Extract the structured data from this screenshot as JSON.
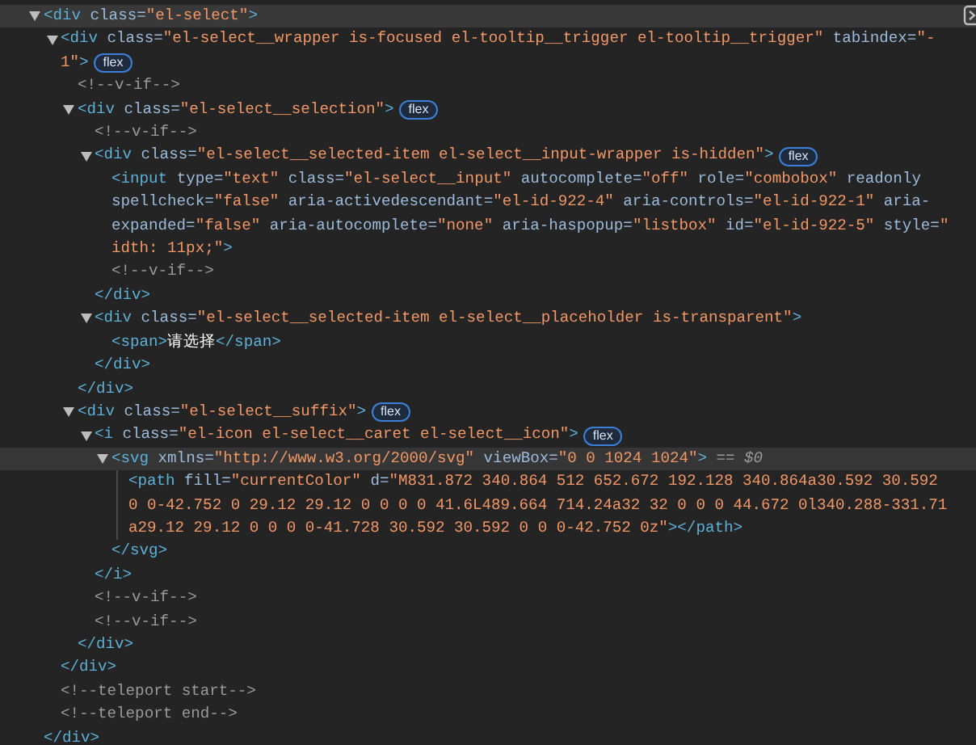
{
  "dom_tree": {
    "nodes": [
      {
        "kind": "element",
        "expanded": true,
        "selected": false,
        "hovered": true,
        "lines": [
          [
            {
              "kind": "tag",
              "text": "<div "
            },
            {
              "kind": "attr",
              "text": "class="
            },
            {
              "kind": "value",
              "text": "\"el-select\""
            },
            {
              "kind": "tag",
              "text": ">"
            }
          ]
        ],
        "children": [
          {
            "kind": "element",
            "expanded": true,
            "selected": false,
            "hovered": false,
            "badge": "flex",
            "lines": [
              [
                {
                  "kind": "tag",
                  "text": "<div "
                },
                {
                  "kind": "attr",
                  "text": "class="
                },
                {
                  "kind": "value",
                  "text": "\"el-select__wrapper is-focused el-tooltip__trigger el-tooltip__trigger\""
                },
                {
                  "kind": "attr",
                  "text": " tabindex="
                },
                {
                  "kind": "value",
                  "text": "\"-"
                }
              ],
              [
                {
                  "kind": "value",
                  "text": "1\""
                },
                {
                  "kind": "tag",
                  "text": ">"
                }
              ]
            ],
            "children": [
              {
                "kind": "comment",
                "text": "<!--v-if-->"
              },
              {
                "kind": "element",
                "expanded": true,
                "selected": false,
                "hovered": false,
                "badge": "flex",
                "lines": [
                  [
                    {
                      "kind": "tag",
                      "text": "<div "
                    },
                    {
                      "kind": "attr",
                      "text": "class="
                    },
                    {
                      "kind": "value",
                      "text": "\"el-select__selection\""
                    },
                    {
                      "kind": "tag",
                      "text": ">"
                    }
                  ]
                ],
                "children": [
                  {
                    "kind": "comment",
                    "text": "<!--v-if-->"
                  },
                  {
                    "kind": "element",
                    "expanded": true,
                    "selected": false,
                    "hovered": false,
                    "badge": "flex",
                    "lines": [
                      [
                        {
                          "kind": "tag",
                          "text": "<div "
                        },
                        {
                          "kind": "attr",
                          "text": "class="
                        },
                        {
                          "kind": "value",
                          "text": "\"el-select__selected-item el-select__input-wrapper is-hidden\""
                        },
                        {
                          "kind": "tag",
                          "text": ">"
                        }
                      ]
                    ],
                    "children": [
                      {
                        "kind": "leaf",
                        "lines": [
                          [
                            {
                              "kind": "tag",
                              "text": "<input "
                            },
                            {
                              "kind": "attr",
                              "text": "type="
                            },
                            {
                              "kind": "value",
                              "text": "\"text\""
                            },
                            {
                              "kind": "attr",
                              "text": " class="
                            },
                            {
                              "kind": "value",
                              "text": "\"el-select__input\""
                            },
                            {
                              "kind": "attr",
                              "text": " autocomplete="
                            },
                            {
                              "kind": "value",
                              "text": "\"off\""
                            },
                            {
                              "kind": "attr",
                              "text": " role="
                            },
                            {
                              "kind": "value",
                              "text": "\"combobox\""
                            },
                            {
                              "kind": "attr",
                              "text": " readonly"
                            }
                          ],
                          [
                            {
                              "kind": "attr",
                              "text": "spellcheck="
                            },
                            {
                              "kind": "value",
                              "text": "\"false\""
                            },
                            {
                              "kind": "attr",
                              "text": " aria-activedescendant="
                            },
                            {
                              "kind": "value",
                              "text": "\"el-id-922-4\""
                            },
                            {
                              "kind": "attr",
                              "text": " aria-controls="
                            },
                            {
                              "kind": "value",
                              "text": "\"el-id-922-1\""
                            },
                            {
                              "kind": "attr",
                              "text": " aria-"
                            }
                          ],
                          [
                            {
                              "kind": "attr",
                              "text": "expanded="
                            },
                            {
                              "kind": "value",
                              "text": "\"false\""
                            },
                            {
                              "kind": "attr",
                              "text": " aria-autocomplete="
                            },
                            {
                              "kind": "value",
                              "text": "\"none\""
                            },
                            {
                              "kind": "attr",
                              "text": " aria-haspopup="
                            },
                            {
                              "kind": "value",
                              "text": "\"listbox\""
                            },
                            {
                              "kind": "attr",
                              "text": " id="
                            },
                            {
                              "kind": "value",
                              "text": "\"el-id-922-5\""
                            },
                            {
                              "kind": "attr",
                              "text": " style="
                            },
                            {
                              "kind": "value",
                              "text": "\""
                            }
                          ],
                          [
                            {
                              "kind": "value",
                              "text": "idth: 11px;\""
                            },
                            {
                              "kind": "tag",
                              "text": ">"
                            }
                          ]
                        ]
                      },
                      {
                        "kind": "comment",
                        "text": "<!--v-if-->"
                      }
                    ],
                    "close": [
                      {
                        "kind": "tag",
                        "text": "</div>"
                      }
                    ]
                  },
                  {
                    "kind": "element",
                    "expanded": true,
                    "selected": false,
                    "hovered": false,
                    "lines": [
                      [
                        {
                          "kind": "tag",
                          "text": "<div "
                        },
                        {
                          "kind": "attr",
                          "text": "class="
                        },
                        {
                          "kind": "value",
                          "text": "\"el-select__selected-item el-select__placeholder is-transparent\""
                        },
                        {
                          "kind": "tag",
                          "text": ">"
                        }
                      ]
                    ],
                    "children": [
                      {
                        "kind": "leaf",
                        "lines": [
                          [
                            {
                              "kind": "tag",
                              "text": "<span>"
                            },
                            {
                              "kind": "text",
                              "text": "请选择"
                            },
                            {
                              "kind": "tag",
                              "text": "</span>"
                            }
                          ]
                        ]
                      }
                    ],
                    "close": [
                      {
                        "kind": "tag",
                        "text": "</div>"
                      }
                    ]
                  }
                ],
                "close": [
                  {
                    "kind": "tag",
                    "text": "</div>"
                  }
                ]
              },
              {
                "kind": "element",
                "expanded": true,
                "selected": false,
                "hovered": false,
                "badge": "flex",
                "lines": [
                  [
                    {
                      "kind": "tag",
                      "text": "<div "
                    },
                    {
                      "kind": "attr",
                      "text": "class="
                    },
                    {
                      "kind": "value",
                      "text": "\"el-select__suffix\""
                    },
                    {
                      "kind": "tag",
                      "text": ">"
                    }
                  ]
                ],
                "children": [
                  {
                    "kind": "element",
                    "expanded": true,
                    "selected": false,
                    "hovered": false,
                    "badge": "flex",
                    "lines": [
                      [
                        {
                          "kind": "tag",
                          "text": "<i "
                        },
                        {
                          "kind": "attr",
                          "text": "class="
                        },
                        {
                          "kind": "value",
                          "text": "\"el-icon el-select__caret el-select__icon\""
                        },
                        {
                          "kind": "tag",
                          "text": ">"
                        }
                      ]
                    ],
                    "children": [
                      {
                        "kind": "element",
                        "expanded": true,
                        "selected": true,
                        "hovered": false,
                        "lines": [
                          [
                            {
                              "kind": "tag",
                              "text": "<svg "
                            },
                            {
                              "kind": "attr",
                              "text": "xmlns="
                            },
                            {
                              "kind": "value",
                              "text": "\"http://www.w3.org/2000/svg\""
                            },
                            {
                              "kind": "attr",
                              "text": " viewBox="
                            },
                            {
                              "kind": "value",
                              "text": "\"0 0 1024 1024\""
                            },
                            {
                              "kind": "tag",
                              "text": ">"
                            }
                          ]
                        ],
                        "suffix": [
                          {
                            "kind": "eq",
                            "text": " == "
                          },
                          {
                            "kind": "var",
                            "text": "$0"
                          }
                        ],
                        "children": [
                          {
                            "kind": "leaf",
                            "lines": [
                              [
                                {
                                  "kind": "tag",
                                  "text": "<path "
                                },
                                {
                                  "kind": "attr",
                                  "text": "fill="
                                },
                                {
                                  "kind": "value",
                                  "text": "\"currentColor\""
                                },
                                {
                                  "kind": "attr",
                                  "text": " d="
                                },
                                {
                                  "kind": "value",
                                  "text": "\"M831.872 340.864 512 652.672 192.128 340.864a30.592 30.592"
                                }
                              ],
                              [
                                {
                                  "kind": "value",
                                  "text": "0 0-42.752 0 29.12 29.12 0 0 0 0 41.6L489.664 714.24a32 32 0 0 0 44.672 0l340.288-331.71"
                                }
                              ],
                              [
                                {
                                  "kind": "value",
                                  "text": "a29.12 29.12 0 0 0 0-41.728 30.592 30.592 0 0 0-42.752 0z\""
                                },
                                {
                                  "kind": "tag",
                                  "text": "></path>"
                                }
                              ]
                            ]
                          }
                        ],
                        "close": [
                          {
                            "kind": "tag",
                            "text": "</svg>"
                          }
                        ]
                      }
                    ],
                    "close": [
                      {
                        "kind": "tag",
                        "text": "</i>"
                      }
                    ]
                  },
                  {
                    "kind": "comment",
                    "text": "<!--v-if-->"
                  },
                  {
                    "kind": "comment",
                    "text": "<!--v-if-->"
                  }
                ],
                "close": [
                  {
                    "kind": "tag",
                    "text": "</div>"
                  }
                ]
              }
            ],
            "close": [
              {
                "kind": "tag",
                "text": "</div>"
              }
            ]
          },
          {
            "kind": "comment",
            "text": "<!--teleport start-->"
          },
          {
            "kind": "comment",
            "text": "<!--teleport end-->"
          }
        ],
        "close": [
          {
            "kind": "tag",
            "text": "</div>"
          }
        ]
      }
    ]
  }
}
